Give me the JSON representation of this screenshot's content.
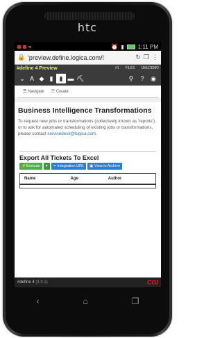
{
  "device": {
    "brand": "htc"
  },
  "status_bar": {
    "time": "1:11",
    "ampm": "PM"
  },
  "browser": {
    "url": "'preview.define.logica.com/!"
  },
  "app": {
    "title": "#define 4 Preview",
    "top_right": [
      "#1",
      "FILES",
      "UMLDEMO"
    ]
  },
  "tabs": [
    {
      "label": "Navigate"
    },
    {
      "label": "Create"
    }
  ],
  "page": {
    "title": "Business Intelligence Transformations",
    "description": "To request new jobs or transformations (collectively known as 'reports'), or to ask for automated scheduling of existing jobs or transformations, please contact ",
    "email": "servicedesk@logica.com",
    "email_suffix": "."
  },
  "export": {
    "title": "Export All Tickets To Excel",
    "buttons": {
      "execute": "Execute",
      "integration": "Integration URL",
      "archive": "View in Archive"
    },
    "columns": [
      "Name",
      "Age",
      "Author"
    ]
  },
  "footer": {
    "app": "#define 4",
    "version": "(4.9.1)",
    "logo": "CGI"
  },
  "colors": {
    "header_bg": "#3b3b3b",
    "title_yellow": "#e8ea80",
    "green": "#4cae4c",
    "blue": "#2a7fd4",
    "link": "#2a6fb0",
    "cgi_red": "#e02020"
  }
}
